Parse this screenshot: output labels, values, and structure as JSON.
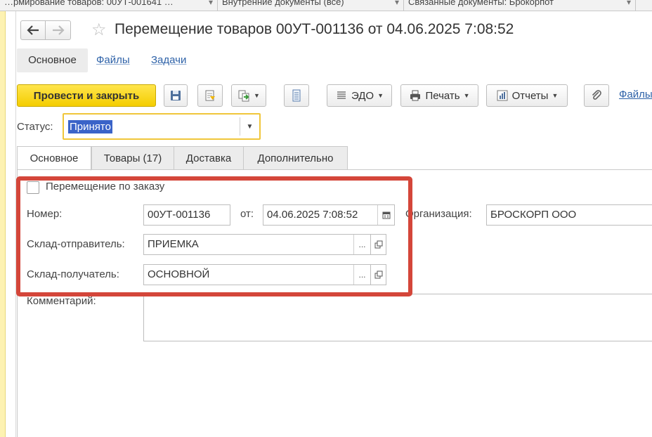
{
  "window_tabs": [
    {
      "label": "…рмирование товаров: 00УТ-001641 …"
    },
    {
      "label": "Внутренние документы (все)"
    },
    {
      "label": "Связанные документы: Брокорпот"
    }
  ],
  "header": {
    "title": "Перемещение товаров 00УТ-001136 от 04.06.2025 7:08:52"
  },
  "sections": {
    "main": "Основное",
    "files": "Файлы",
    "tasks": "Задачи"
  },
  "toolbar": {
    "post_close": "Провести и закрыть",
    "edo": "ЭДО",
    "print": "Печать",
    "reports": "Отчеты",
    "files_link": "Файлы"
  },
  "status": {
    "label": "Статус:",
    "value": "Принято"
  },
  "form_tabs": [
    {
      "label": "Основное"
    },
    {
      "label": "Товары (17)"
    },
    {
      "label": "Доставка"
    },
    {
      "label": "Дополнительно"
    }
  ],
  "form": {
    "by_order_label": "Перемещение по заказу",
    "number_label": "Номер:",
    "number_value": "00УТ-001136",
    "from_label": "от:",
    "date_value": "04.06.2025  7:08:52",
    "org_label": "Организация:",
    "org_value": "БРОСКОРП ООО",
    "sender_label": "Склад-отправитель:",
    "sender_value": "ПРИЕМКА",
    "receiver_label": "Склад-получатель:",
    "receiver_value": "ОСНОВНОЙ",
    "comment_label": "Комментарий:",
    "ellipsis": "..."
  },
  "colors": {
    "primary_button": "#f4cd00",
    "highlight": "#d4463a",
    "link": "#2e62a8",
    "status_focus": "#f0c63a"
  }
}
